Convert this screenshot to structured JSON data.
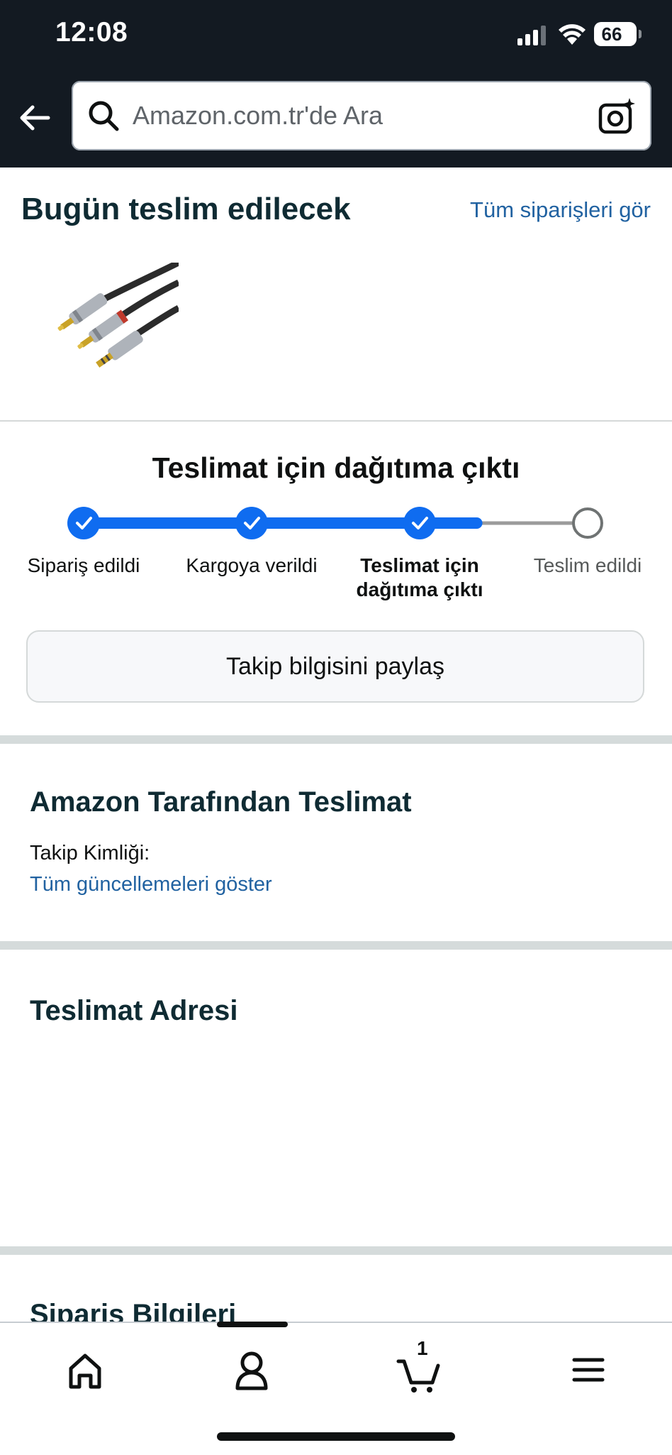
{
  "status_bar": {
    "time": "12:08",
    "battery": "66"
  },
  "search": {
    "placeholder": "Amazon.com.tr'de Ara"
  },
  "delivery": {
    "title": "Bugün teslim edilecek",
    "all_orders_link": "Tüm siparişleri gör",
    "product_image": "rca-audio-cable"
  },
  "tracking": {
    "status_title": "Teslimat için dağıtıma çıktı",
    "steps": [
      {
        "label": "Sipariş edildi",
        "state": "done"
      },
      {
        "label": "Kargoya verildi",
        "state": "done"
      },
      {
        "label": "Teslimat için dağıtıma çıktı",
        "state": "active"
      },
      {
        "label": "Teslim edildi",
        "state": "pending"
      }
    ],
    "progress_fraction": 0.78,
    "share_button": "Takip bilgisini paylaş"
  },
  "carrier": {
    "title": "Amazon Tarafından Teslimat",
    "tracking_id_label": "Takip Kimliği:",
    "updates_link": "Tüm güncellemeleri göster"
  },
  "address": {
    "title": "Teslimat Adresi"
  },
  "order_info": {
    "title": "Sipariş Bilgileri"
  },
  "tabbar": {
    "items": [
      "home-icon",
      "account-icon",
      "cart-icon",
      "menu-icon"
    ],
    "cart_count": "1"
  },
  "colors": {
    "header_bg": "#131a22",
    "progress_blue": "#0f6cf0",
    "link_blue": "#2162a1",
    "title_teal": "#0f2b33"
  }
}
